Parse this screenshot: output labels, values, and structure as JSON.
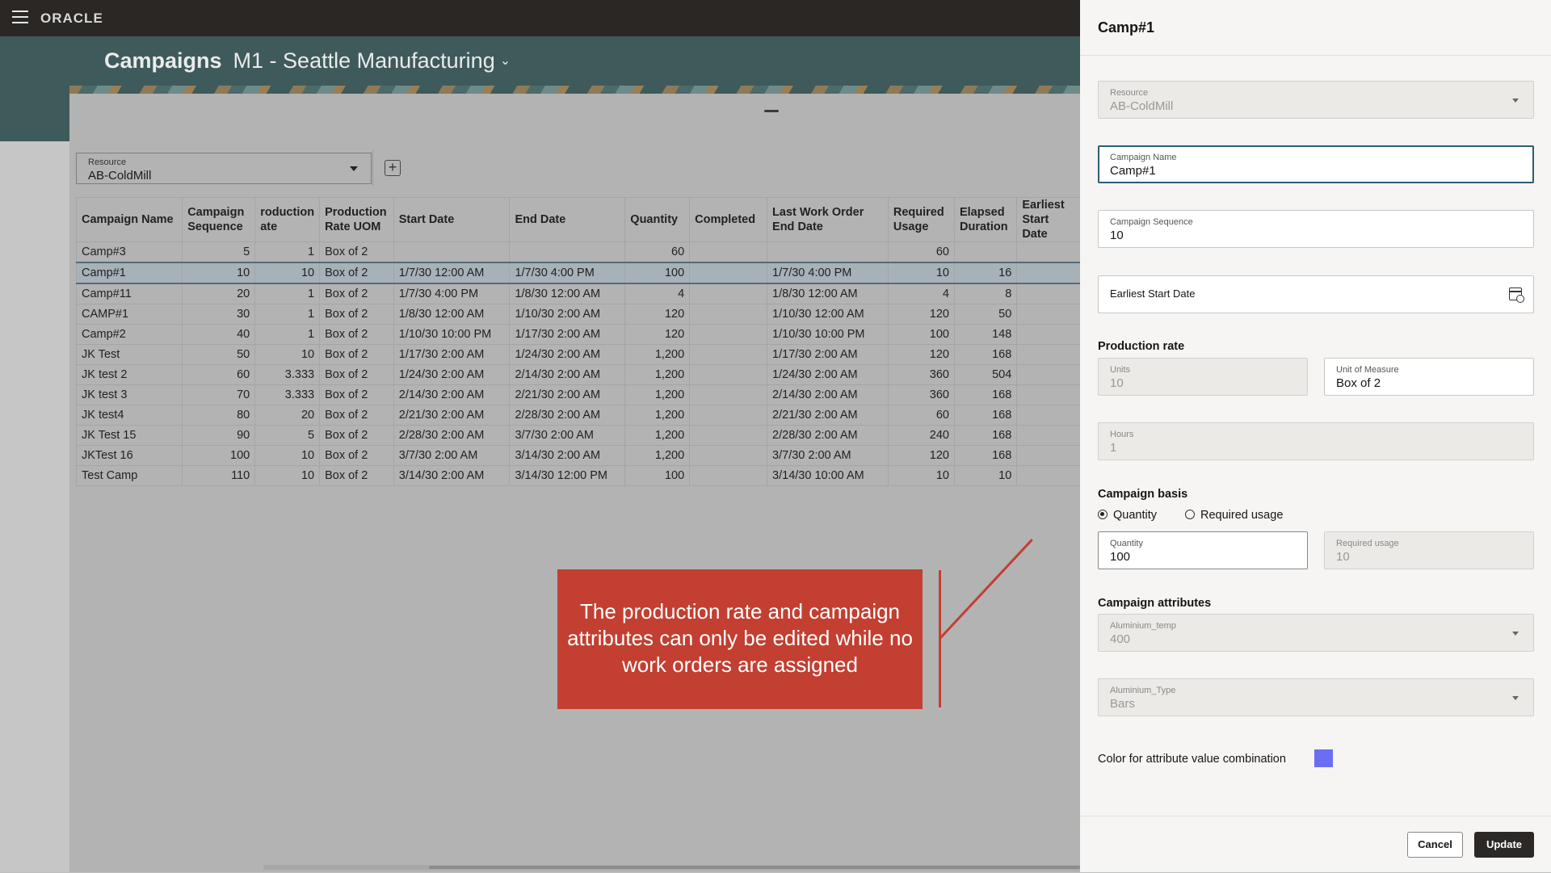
{
  "app": {
    "brand": "ORACLE"
  },
  "header": {
    "title": "Campaigns",
    "subtitle": "M1 - Seattle Manufacturing"
  },
  "resource_filter": {
    "label": "Resource",
    "value": "AB-ColdMill"
  },
  "table": {
    "columns": [
      "Campaign Name",
      "Campaign Sequence",
      "roduction ate",
      "Production Rate UOM",
      "Start Date",
      "End Date",
      "Quantity",
      "Completed",
      "Last Work Order End Date",
      "Required Usage",
      "Elapsed Duration",
      "Earliest Start Date"
    ],
    "rows": [
      [
        "Camp#3",
        "5",
        "1",
        "Box of 2",
        "",
        "",
        "60",
        "",
        "",
        "60",
        "",
        ""
      ],
      [
        "Camp#1",
        "10",
        "10",
        "Box of 2",
        "1/7/30 12:00 AM",
        "1/7/30 4:00 PM",
        "100",
        "",
        "1/7/30 4:00 PM",
        "10",
        "16",
        ""
      ],
      [
        "Camp#11",
        "20",
        "1",
        "Box of 2",
        "1/7/30 4:00 PM",
        "1/8/30 12:00 AM",
        "4",
        "",
        "1/8/30 12:00 AM",
        "4",
        "8",
        ""
      ],
      [
        "CAMP#1",
        "30",
        "1",
        "Box of 2",
        "1/8/30 12:00 AM",
        "1/10/30 2:00 AM",
        "120",
        "",
        "1/10/30 12:00 AM",
        "120",
        "50",
        ""
      ],
      [
        "Camp#2",
        "40",
        "1",
        "Box of 2",
        "1/10/30 10:00 PM",
        "1/17/30 2:00 AM",
        "120",
        "",
        "1/10/30 10:00 PM",
        "100",
        "148",
        ""
      ],
      [
        "JK Test",
        "50",
        "10",
        "Box of 2",
        "1/17/30 2:00 AM",
        "1/24/30 2:00 AM",
        "1,200",
        "",
        "1/17/30 2:00 AM",
        "120",
        "168",
        ""
      ],
      [
        "JK test 2",
        "60",
        "3.333",
        "Box of 2",
        "1/24/30 2:00 AM",
        "2/14/30 2:00 AM",
        "1,200",
        "",
        "1/24/30 2:00 AM",
        "360",
        "504",
        ""
      ],
      [
        "JK test 3",
        "70",
        "3.333",
        "Box of 2",
        "2/14/30 2:00 AM",
        "2/21/30 2:00 AM",
        "1,200",
        "",
        "2/14/30 2:00 AM",
        "360",
        "168",
        ""
      ],
      [
        "JK test4",
        "80",
        "20",
        "Box of 2",
        "2/21/30 2:00 AM",
        "2/28/30 2:00 AM",
        "1,200",
        "",
        "2/21/30 2:00 AM",
        "60",
        "168",
        ""
      ],
      [
        "JK Test 15",
        "90",
        "5",
        "Box of 2",
        "2/28/30 2:00 AM",
        "3/7/30 2:00 AM",
        "1,200",
        "",
        "2/28/30 2:00 AM",
        "240",
        "168",
        ""
      ],
      [
        "JKTest 16",
        "100",
        "10",
        "Box of 2",
        "3/7/30 2:00 AM",
        "3/14/30 2:00 AM",
        "1,200",
        "",
        "3/7/30 2:00 AM",
        "120",
        "168",
        ""
      ],
      [
        "Test Camp",
        "110",
        "10",
        "Box of 2",
        "3/14/30 2:00 AM",
        "3/14/30 12:00 PM",
        "100",
        "",
        "3/14/30 10:00 AM",
        "10",
        "10",
        ""
      ]
    ]
  },
  "callout": {
    "text": "The production rate and campaign attributes can only be edited while no work orders are assigned"
  },
  "drawer": {
    "title": "Camp#1",
    "resource": {
      "label": "Resource",
      "value": "AB-ColdMill"
    },
    "campaign_name": {
      "label": "Campaign Name",
      "value": "Camp#1"
    },
    "campaign_sequence": {
      "label": "Campaign Sequence",
      "value": "10"
    },
    "earliest_start_date": {
      "label": "Earliest Start Date"
    },
    "production_rate": {
      "heading": "Production rate",
      "units": {
        "label": "Units",
        "value": "10"
      },
      "uom": {
        "label": "Unit of Measure",
        "value": "Box of 2"
      },
      "hours": {
        "label": "Hours",
        "value": "1"
      }
    },
    "campaign_basis": {
      "heading": "Campaign basis",
      "options": [
        "Quantity",
        "Required usage"
      ],
      "selected": "Quantity",
      "quantity": {
        "label": "Quantity",
        "value": "100"
      },
      "required_usage": {
        "label": "Required usage",
        "value": "10"
      }
    },
    "attributes": {
      "heading": "Campaign attributes",
      "temp": {
        "label": "Aluminium_temp",
        "value": "400"
      },
      "type": {
        "label": "Aluminium_Type",
        "value": "Bars"
      }
    },
    "color": {
      "label": "Color for attribute value combination",
      "value": "#6b6ef2"
    },
    "cancel_label": "Cancel",
    "update_label": "Update"
  }
}
